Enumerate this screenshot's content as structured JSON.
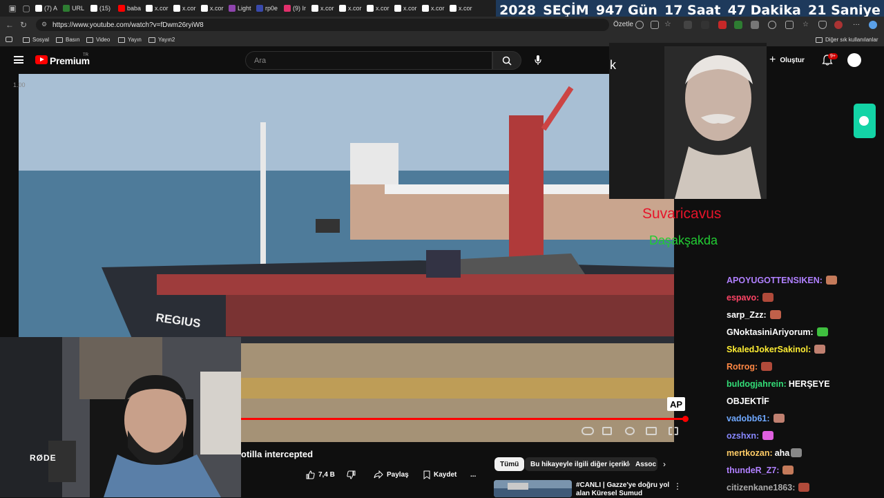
{
  "browser": {
    "tabs": [
      {
        "label": "(7) A",
        "color": "#ffffff"
      },
      {
        "label": "URL",
        "color": "#2e7d32"
      },
      {
        "label": "(15)",
        "color": "#ffffff"
      },
      {
        "label": "baba",
        "color": "#ff0000"
      },
      {
        "label": "x.cor",
        "color": "#ffffff"
      },
      {
        "label": "x.cor",
        "color": "#ffffff"
      },
      {
        "label": "x.cor",
        "color": "#ffffff"
      },
      {
        "label": "Light",
        "color": "#8e44ad"
      },
      {
        "label": "rp0e",
        "color": "#3949ab"
      },
      {
        "label": "(9) Ir",
        "color": "#e1306c"
      },
      {
        "label": "x.cor",
        "color": "#ffffff"
      },
      {
        "label": "x.cor",
        "color": "#ffffff"
      },
      {
        "label": "x.cor",
        "color": "#ffffff"
      },
      {
        "label": "x.cor",
        "color": "#ffffff"
      },
      {
        "label": "x.cor",
        "color": "#ffffff"
      },
      {
        "label": "x.cor",
        "color": "#ffffff"
      }
    ],
    "url": "https://www.youtube.com/watch?v=fDwm26ryiW8",
    "summary_label": "Özetle",
    "bookmarks": [
      "Sosyal",
      "Basın",
      "Video",
      "Yayın",
      "Yayın2"
    ],
    "other_bookmarks": "Diğer sık kullanılanlar"
  },
  "countdown": {
    "year": "2028",
    "label": "SEÇİM",
    "days": "947 Gün",
    "hours": "17 Saat",
    "minutes": "47 Dakika",
    "seconds": "21 Saniye"
  },
  "youtube": {
    "brand": "Premium",
    "region": "TR",
    "search_placeholder": "Ara",
    "create_label": "Oluştur",
    "notif_count": "9+",
    "speed": "1.00",
    "watermark": "AP",
    "video_title": "otilla intercepted",
    "likes": "7,4 B",
    "share_label": "Paylaş",
    "save_label": "Kaydet",
    "more_label": "...",
    "chips": [
      "Tümü",
      "Bu hikayeyle ilgili diğer içerikler",
      "Assoc"
    ],
    "recommended_title": "#CANLI | Gazze'ye doğru yol alan Küresel Sumud Filosu'na"
  },
  "overlay": {
    "cam_letter": "k",
    "name_red": "Suvaricavus",
    "name_green": "Daşakşakda",
    "mic_brand": "RØDE"
  },
  "chat": [
    {
      "user": "APOYUGOTTENSIKEN:",
      "text": "",
      "color": "#b080ff"
    },
    {
      "user": "espavo:",
      "text": "",
      "color": "#ff4466"
    },
    {
      "user": "sarp_Zzz:",
      "text": "",
      "color": "#ffffff"
    },
    {
      "user": "GNoktasiniAriyorum:",
      "text": "",
      "color": "#ffffff"
    },
    {
      "user": "SkaledJokerSakinol:",
      "text": "",
      "color": "#ffee33"
    },
    {
      "user": "Rotrog:",
      "text": "",
      "color": "#ff8844"
    },
    {
      "user": "buldogjahrein:",
      "text": "HERŞEYE",
      "color": "#33dd77"
    },
    {
      "user": "",
      "text": "OBJEKTİF",
      "color": "#ffffff"
    },
    {
      "user": "vadobb61:",
      "text": "",
      "color": "#6fa8ff"
    },
    {
      "user": "ozshxn:",
      "text": "",
      "color": "#8888ff"
    },
    {
      "user": "mertkozan:",
      "text": "aha",
      "color": "#ffcc66"
    },
    {
      "user": "thundeR_Z7:",
      "text": "",
      "color": "#b080ff"
    },
    {
      "user": "citizenkane1863:",
      "text": "",
      "color": "#aaaaaa"
    }
  ]
}
